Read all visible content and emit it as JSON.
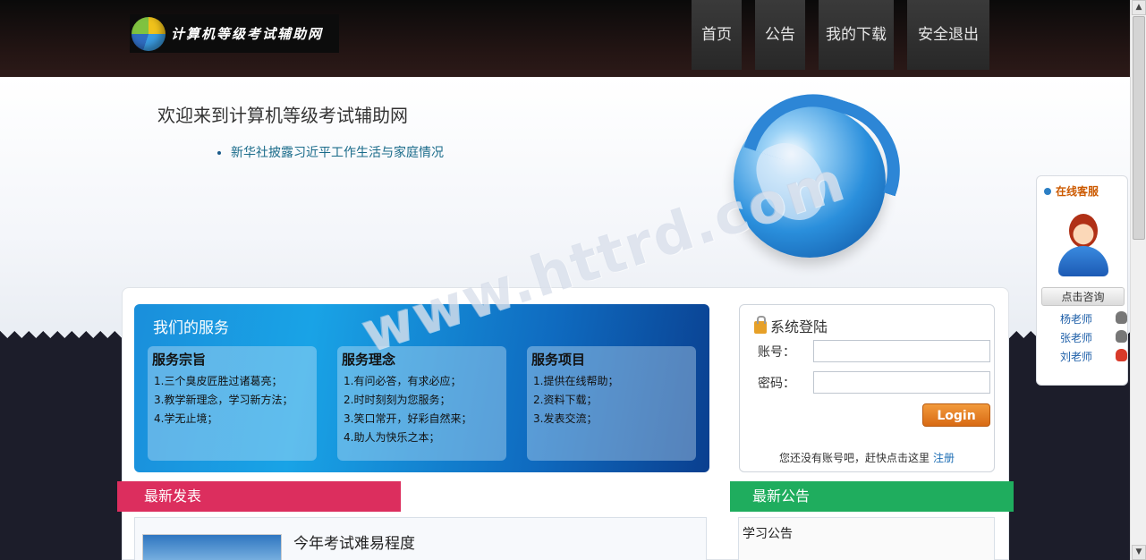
{
  "header": {
    "logo_text": "计算机等级考试辅助网",
    "nav": [
      {
        "label": "首页"
      },
      {
        "label": "公告"
      },
      {
        "label": "我的下载"
      },
      {
        "label": "安全退出"
      }
    ]
  },
  "hero": {
    "welcome": "欢迎来到计算机等级考试辅助网",
    "news": [
      "新华社披露习近平工作生活与家庭情况"
    ],
    "watermark": "www.httrd.com"
  },
  "services": {
    "title": "我们的服务",
    "boxes": [
      {
        "heading": "服务宗旨",
        "items": [
          "1.三个臭皮匠胜过诸葛亮；",
          "3.教学新理念，学习新方法；",
          "4.学无止境；"
        ]
      },
      {
        "heading": "服务理念",
        "items": [
          "1.有问必答，有求必应；",
          "2.时时刻刻为您服务；",
          "3.笑口常开，好彩自然来；",
          "4.助人为快乐之本；"
        ]
      },
      {
        "heading": "服务项目",
        "items": [
          "1.提供在线帮助；",
          "2.资料下载；",
          "3.发表交流；"
        ]
      }
    ]
  },
  "login": {
    "title": "系统登陆",
    "account_label": "账号：",
    "account_value": "",
    "password_label": "密码：",
    "password_value": "",
    "button": "Login",
    "register_prompt": "您还没有账号吧，赶快点击这里",
    "register_link": "注册"
  },
  "latest": {
    "header": "最新发表",
    "article_title": "今年考试难易程度"
  },
  "notices": {
    "header": "最新公告",
    "items": [
      "学习公告"
    ]
  },
  "customer_service": {
    "title": "在线客服",
    "consult_button": "点击咨询",
    "teachers": [
      {
        "name": "杨老师",
        "status": "offline"
      },
      {
        "name": "张老师",
        "status": "offline"
      },
      {
        "name": "刘老师",
        "status": "online"
      }
    ]
  },
  "colors": {
    "header_bg": "#241514",
    "services_blue": "#1a8fdb",
    "latest_header": "#dc2e5e",
    "notice_header": "#1fad5e",
    "login_button": "#e2781f",
    "customer_title": "#cc5a00"
  }
}
